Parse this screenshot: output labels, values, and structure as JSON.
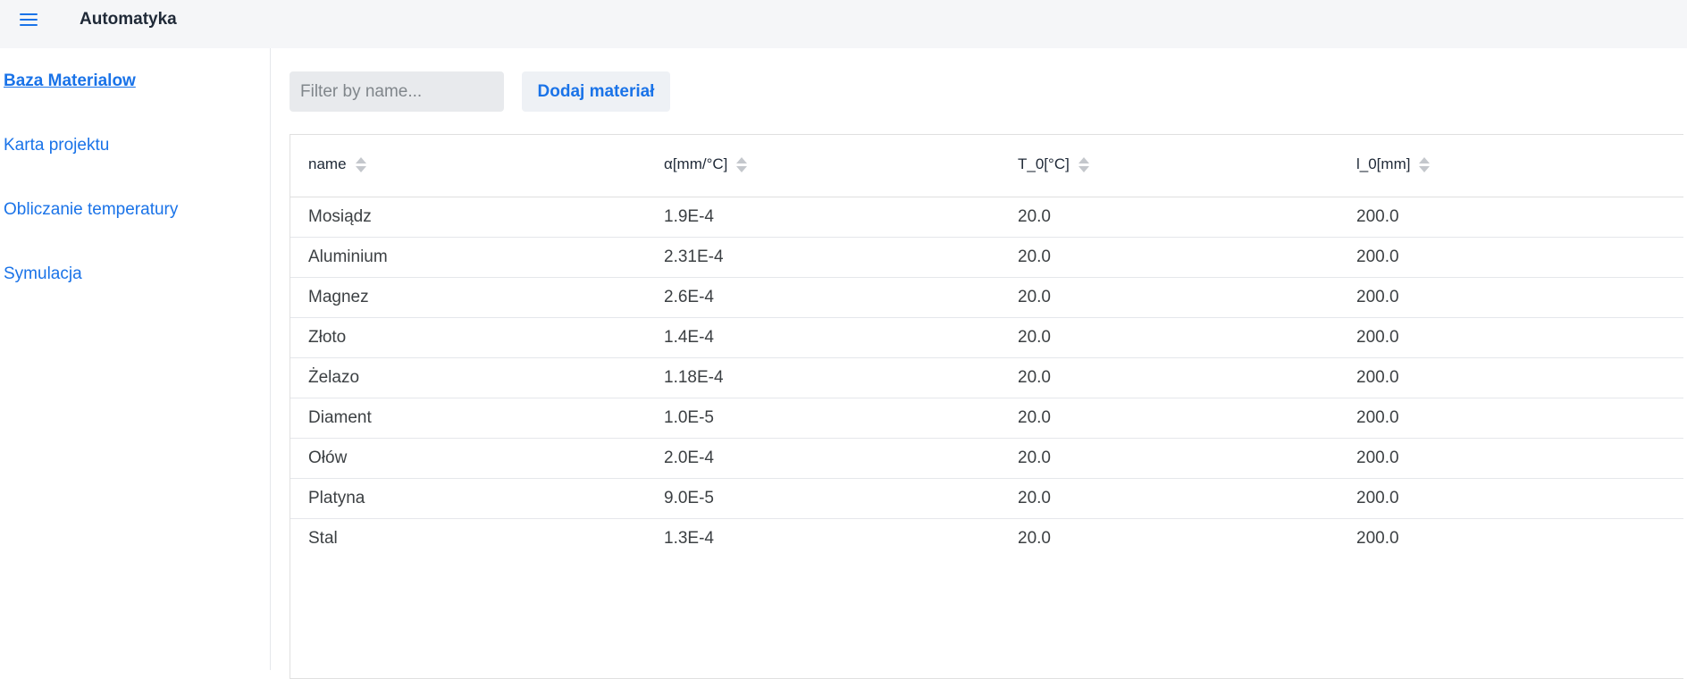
{
  "app": {
    "title": "Automatyka"
  },
  "sidebar": {
    "items": [
      {
        "label": "Baza Materialow",
        "active": true
      },
      {
        "label": "Karta projektu",
        "active": false
      },
      {
        "label": "Obliczanie temperatury",
        "active": false
      },
      {
        "label": "Symulacja",
        "active": false
      }
    ]
  },
  "toolbar": {
    "filter_placeholder": "Filter by name...",
    "filter_value": "",
    "add_label": "Dodaj materiał"
  },
  "table": {
    "columns": [
      "name",
      "α[mm/°C]",
      "T_0[°C]",
      "l_0[mm]"
    ],
    "rows": [
      [
        "Mosiądz",
        "1.9E-4",
        "20.0",
        "200.0"
      ],
      [
        "Aluminium",
        "2.31E-4",
        "20.0",
        "200.0"
      ],
      [
        "Magnez",
        "2.6E-4",
        "20.0",
        "200.0"
      ],
      [
        "Złoto",
        "1.4E-4",
        "20.0",
        "200.0"
      ],
      [
        "Żelazo",
        "1.18E-4",
        "20.0",
        "200.0"
      ],
      [
        "Diament",
        "1.0E-5",
        "20.0",
        "200.0"
      ],
      [
        "Ołów",
        "2.0E-4",
        "20.0",
        "200.0"
      ],
      [
        "Platyna",
        "9.0E-5",
        "20.0",
        "200.0"
      ],
      [
        "Stal",
        "1.3E-4",
        "20.0",
        "200.0"
      ]
    ]
  },
  "colors": {
    "accent": "#1a73e8",
    "navbar_bg": "#f5f6f8",
    "input_bg": "#e8eaed"
  }
}
